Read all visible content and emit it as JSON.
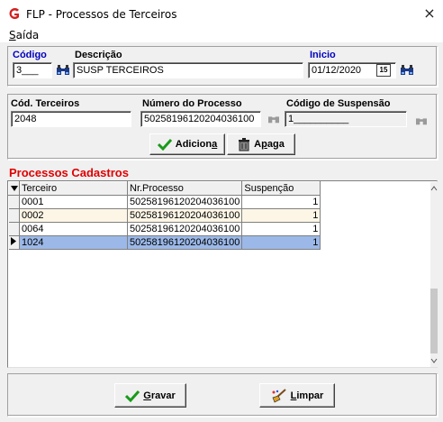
{
  "window": {
    "title": "FLP - Processos de Terceiros",
    "close_glyph": "×"
  },
  "menu": {
    "saida": {
      "hotkey": "S",
      "rest": "aída"
    }
  },
  "header": {
    "codigo_label": "Código",
    "codigo_value": "3___",
    "descricao_label": "Descrição",
    "descricao_value": "SUSP TERCEIROS",
    "inicio_label": "Inicio",
    "inicio_value": "01/12/2020",
    "calendar_day": "15"
  },
  "process": {
    "cod_terceiros_label": "Cód. Terceiros",
    "cod_terceiros_value": "2048",
    "numero_processo_label": "Número do Processo",
    "numero_processo_value": "50258196120204036100",
    "codigo_suspensao_label": "Código de Suspensão",
    "codigo_suspensao_value": "1__________",
    "adiciona_pre": "Adicion",
    "adiciona_hot": "a",
    "apaga_pre": "A",
    "apaga_hot": "p",
    "apaga_post": "aga"
  },
  "section_title": "Processos Cadastros",
  "grid": {
    "columns": [
      "Terceiro",
      "Nr.Processo",
      "Suspenção"
    ],
    "rows": [
      {
        "terceiro": "0001",
        "processo": "50258196120204036100",
        "suspensao": "1"
      },
      {
        "terceiro": "0002",
        "processo": "50258196120204036100",
        "suspensao": "1"
      },
      {
        "terceiro": "0064",
        "processo": "50258196120204036100",
        "suspensao": "1"
      },
      {
        "terceiro": "1024",
        "processo": "50258196120204036100",
        "suspensao": "1"
      }
    ],
    "selected_row": 3
  },
  "footer": {
    "gravar_hot": "G",
    "gravar_rest": "ravar",
    "limpar_hot": "L",
    "limpar_rest": "impar"
  },
  "colors": {
    "accent_red": "#e00000",
    "label_blue": "#0000c0",
    "selection": "#9bb8e8",
    "alt_row": "#fdf6e6"
  }
}
